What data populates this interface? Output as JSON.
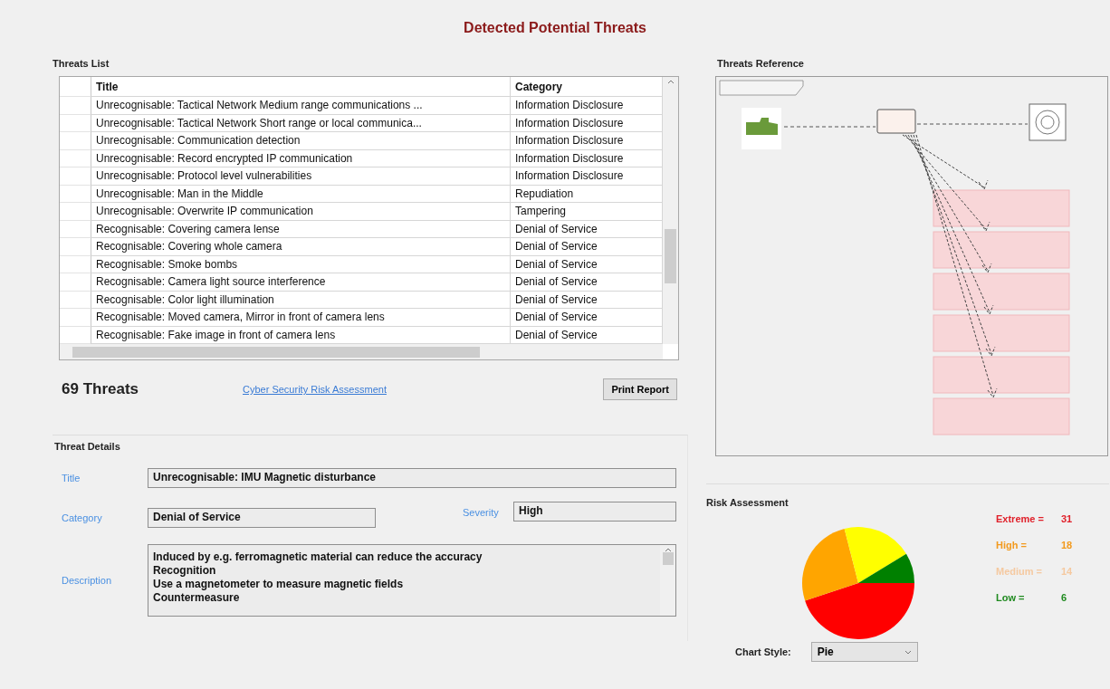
{
  "window": {
    "title": "Detected Potential Threats"
  },
  "threats_list": {
    "label": "Threats List",
    "columns": [
      "Title",
      "Category"
    ],
    "rows": [
      {
        "title": "Unrecognisable: Tactical Network Medium range communications ...",
        "category": "Information Disclosure"
      },
      {
        "title": "Unrecognisable: Tactical Network Short range or local communica...",
        "category": "Information Disclosure"
      },
      {
        "title": "Unrecognisable: Communication detection",
        "category": "Information Disclosure"
      },
      {
        "title": "Unrecognisable: Record encrypted IP communication",
        "category": "Information Disclosure"
      },
      {
        "title": "Unrecognisable: Protocol level vulnerabilities",
        "category": "Information Disclosure"
      },
      {
        "title": "Unrecognisable: Man in the Middle",
        "category": "Repudiation"
      },
      {
        "title": "Unrecognisable: Overwrite IP communication",
        "category": "Tampering"
      },
      {
        "title": "Recognisable: Covering camera lense",
        "category": "Denial of Service"
      },
      {
        "title": "Recognisable: Covering whole camera",
        "category": "Denial of Service"
      },
      {
        "title": "Recognisable: Smoke bombs",
        "category": "Denial of Service"
      },
      {
        "title": "Recognisable: Camera light source interference",
        "category": "Denial of Service"
      },
      {
        "title": "Recognisable: Color light illumination",
        "category": "Denial of Service"
      },
      {
        "title": "Recognisable: Moved camera, Mirror in front of camera lens",
        "category": "Denial of Service"
      },
      {
        "title": "Recognisable: Fake image in front of camera lens",
        "category": "Denial of Service"
      }
    ]
  },
  "summary": {
    "count": "69 Threats",
    "link": "Cyber Security Risk Assessment",
    "print_button": "Print Report"
  },
  "threat_details": {
    "label": "Threat Details",
    "title": {
      "label": "Title",
      "value": "Unrecognisable: IMU Magnetic disturbance"
    },
    "category": {
      "label": "Category",
      "value": "Denial of Service"
    },
    "severity": {
      "label": "Severity",
      "value": "High"
    },
    "description": {
      "label": "Description",
      "lines": [
        "Induced by e.g. ferromagnetic material can reduce the accuracy",
        "Recognition",
        "Use a magnetometer to measure magnetic fields",
        "Countermeasure"
      ]
    }
  },
  "threats_reference": {
    "label": "Threats Reference"
  },
  "risk_assessment": {
    "label": "Risk Assessment",
    "legend": [
      {
        "label": "Extreme =",
        "count": "31",
        "color": "#e0202a"
      },
      {
        "label": "High =",
        "count": "18",
        "color": "#f29a1e"
      },
      {
        "label": "Medium =",
        "count": "14",
        "color": "#f5c9a0"
      },
      {
        "label": "Low =",
        "count": "6",
        "color": "#1f8a1f"
      }
    ],
    "pie": {
      "slices": [
        {
          "color": "#ff0000"
        },
        {
          "color": "#ffa500"
        },
        {
          "color": "#ffff00"
        },
        {
          "color": "#008000"
        }
      ]
    },
    "chart_style": {
      "label": "Chart Style:",
      "value": "Pie"
    }
  }
}
